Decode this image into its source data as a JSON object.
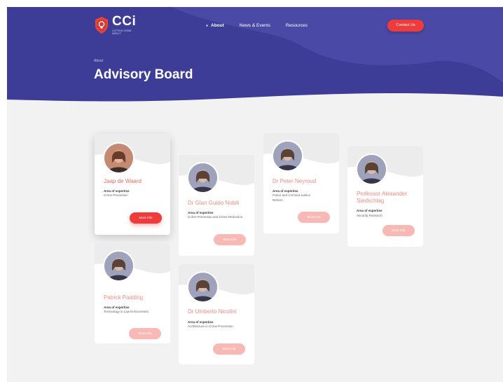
{
  "header": {
    "logo": {
      "name": "CCi",
      "tagline": "CUTTING CRIME IMPACT"
    },
    "nav": [
      {
        "label": "About",
        "active": true
      },
      {
        "label": "News & Events",
        "active": false
      },
      {
        "label": "Resources",
        "active": false
      }
    ],
    "contact_label": "Contact Us"
  },
  "hero": {
    "breadcrumb": "About",
    "title": "Advisory Board"
  },
  "card_common": {
    "aoe_label": "Area of expertise",
    "more_label": "More Info"
  },
  "members": [
    {
      "name": "Jaap de Waard",
      "expertise": "Crime Prevention"
    },
    {
      "name": "Patrick Padding",
      "expertise": "Technology in Law Enforcement"
    },
    {
      "name": "Dr Gian Guido Nobili",
      "expertise": "Crime Prevention and Crime Reduction"
    },
    {
      "name": "Dr Umberto Nicolini",
      "expertise": "Architecture in Crime Prevention"
    },
    {
      "name": "Dr Peter Neyroud",
      "expertise": "Police and Criminal Justice Reform"
    },
    {
      "name": "Professor Alexander Siedschlag",
      "expertise": "Security Research"
    }
  ],
  "colors": {
    "hero": "#3c3b95",
    "accent": "#ef3b3a",
    "name_text": "#f26b5e",
    "button_faded": "#f8b9b4"
  },
  "icons": {
    "logo": "shield-lightbulb-icon"
  }
}
